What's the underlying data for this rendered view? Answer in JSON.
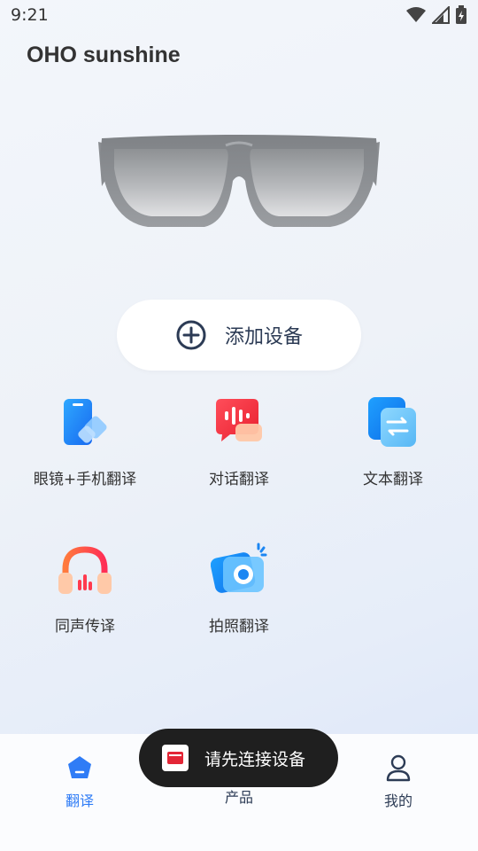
{
  "status_bar": {
    "time": "9:21",
    "icons": [
      "wifi-icon",
      "signal-icon",
      "battery-icon"
    ]
  },
  "header": {
    "title": "OHO sunshine"
  },
  "device_image": "sunglasses",
  "add_device": {
    "label": "添加设备",
    "icon": "plus-circle-icon"
  },
  "features": [
    {
      "label": "眼镜+手机翻译",
      "icon": "glasses-phone-translate-icon"
    },
    {
      "label": "对话翻译",
      "icon": "dialog-translate-icon"
    },
    {
      "label": "文本翻译",
      "icon": "text-translate-icon"
    },
    {
      "label": "同声传译",
      "icon": "headphones-icon"
    },
    {
      "label": "拍照翻译",
      "icon": "camera-icon"
    }
  ],
  "bottom_nav": {
    "items": [
      {
        "label": "翻译",
        "icon": "translate-tab-icon",
        "active": true
      },
      {
        "label": "产品",
        "icon": "product-tab-icon",
        "active": false
      },
      {
        "label": "我的",
        "icon": "user-icon",
        "active": false
      }
    ]
  },
  "toast": {
    "message": "请先连接设备"
  },
  "colors": {
    "accent": "#2f7cf6",
    "toast_bg": "#1f1f1f",
    "nav_inactive": "#2c3b55"
  }
}
